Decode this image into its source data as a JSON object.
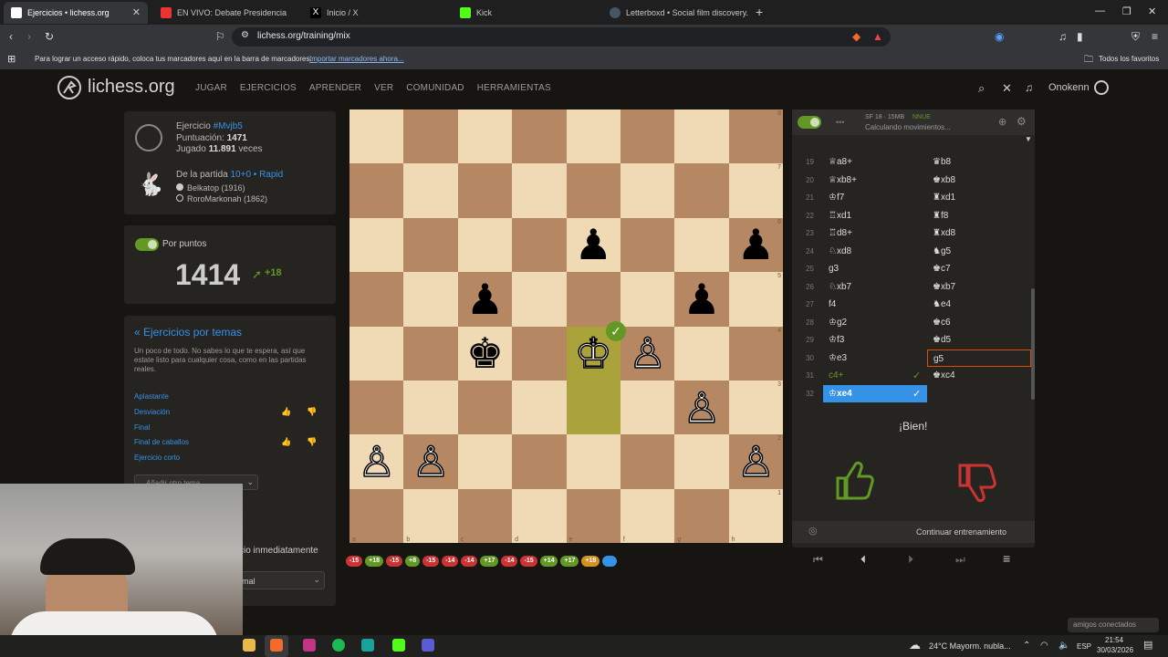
{
  "browser": {
    "tabs": [
      {
        "title": "Ejercicios • lichess.org",
        "active": true
      },
      {
        "title": "EN VIVO: Debate Presidencia",
        "active": false
      },
      {
        "title": "Inicio / X",
        "active": false
      },
      {
        "title": "Kick",
        "active": false
      },
      {
        "title": "Letterboxd • Social film discovery.",
        "active": false
      }
    ],
    "url": "lichess.org/training/mix",
    "bookmarks_hint": "Para lograr un acceso rápido, coloca tus marcadores aquí en la barra de marcadores.",
    "bookmarks_import": "Importar marcadores ahora...",
    "all_favorites": "Todos los favoritos"
  },
  "site": {
    "logo_text": "lichess.org",
    "nav": [
      "JUGAR",
      "EJERCICIOS",
      "APRENDER",
      "VER",
      "COMUNIDAD",
      "HERRAMIENTAS"
    ],
    "username": "Onokenn"
  },
  "puzzle": {
    "label": "Ejercicio",
    "id": "#Mvjb5",
    "rating_label": "Puntuación:",
    "rating": "1471",
    "played_label": "Jugado",
    "played": "11.891",
    "played_suffix": "veces",
    "from_game": "De la partida",
    "game_type": "10+0 • Rapid",
    "white_player": "Belkatop (1916)",
    "black_player": "RoroMarkonah (1862)"
  },
  "score": {
    "label": "Por puntos",
    "value": "1414",
    "delta": "+18"
  },
  "themes": {
    "title": "« Ejercicios por temas",
    "desc": "Un poco de todo. No sabes lo que te espera, así que estate listo para cualquier cosa, como en las partidas reales.",
    "items": [
      "Aplastante",
      "Desviación",
      "Final",
      "Final de caballos",
      "Ejercicio corto"
    ],
    "add": "Añadir otro tema",
    "partial1": "cio inmediatamente",
    "partial2": "mal"
  },
  "engine": {
    "name": "SF 18 · 15MB",
    "nnue": "NNUE",
    "status": "Calculando movimientos..."
  },
  "moves": [
    {
      "n": "19",
      "w": "♕a8+",
      "b": "♛b8"
    },
    {
      "n": "20",
      "w": "♕xb8+",
      "b": "♚xb8"
    },
    {
      "n": "21",
      "w": "♔f7",
      "b": "♜xd1"
    },
    {
      "n": "22",
      "w": "♖xd1",
      "b": "♜f8"
    },
    {
      "n": "23",
      "w": "♖d8+",
      "b": "♜xd8"
    },
    {
      "n": "24",
      "w": "♘xd8",
      "b": "♞g5"
    },
    {
      "n": "25",
      "w": "g3",
      "b": "♚c7"
    },
    {
      "n": "26",
      "w": "♘xb7",
      "b": "♚xb7"
    },
    {
      "n": "27",
      "w": "f4",
      "b": "♞e4"
    },
    {
      "n": "28",
      "w": "♔g2",
      "b": "♚c6"
    },
    {
      "n": "29",
      "w": "♔f3",
      "b": "♚d5"
    },
    {
      "n": "30",
      "w": "♔e3",
      "b": "g5"
    },
    {
      "n": "31",
      "w": "c4+",
      "b": "♚xc4"
    },
    {
      "n": "32",
      "w": "♔xe4",
      "b": ""
    }
  ],
  "feedback": {
    "good": "¡Bien!",
    "continue": "Continuar entrenamiento"
  },
  "chips": [
    {
      "t": "-15",
      "c": "r"
    },
    {
      "t": "+18",
      "c": "g"
    },
    {
      "t": "-15",
      "c": "r"
    },
    {
      "t": "+8",
      "c": "g"
    },
    {
      "t": "-15",
      "c": "r"
    },
    {
      "t": "-14",
      "c": "r"
    },
    {
      "t": "-14",
      "c": "r"
    },
    {
      "t": "+17",
      "c": "g"
    },
    {
      "t": "-14",
      "c": "r"
    },
    {
      "t": "-15",
      "c": "r"
    },
    {
      "t": "+14",
      "c": "g"
    },
    {
      "t": "+17",
      "c": "g"
    },
    {
      "t": "+18",
      "c": "o"
    },
    {
      "t": "",
      "c": "bl"
    }
  ],
  "board": {
    "ranks": [
      "8",
      "7",
      "6",
      "5",
      "4",
      "3",
      "2",
      "1"
    ],
    "files": [
      "a",
      "b",
      "c",
      "d",
      "e",
      "f",
      "g",
      "h"
    ],
    "pieces": [
      {
        "sq": "e6",
        "p": "♟",
        "c": "b"
      },
      {
        "sq": "h6",
        "p": "♟",
        "c": "b"
      },
      {
        "sq": "c5",
        "p": "♟",
        "c": "b"
      },
      {
        "sq": "g5",
        "p": "♟",
        "c": "b"
      },
      {
        "sq": "c4",
        "p": "♚",
        "c": "b"
      },
      {
        "sq": "e4",
        "p": "♔",
        "c": "w"
      },
      {
        "sq": "f4",
        "p": "♙",
        "c": "w"
      },
      {
        "sq": "g3",
        "p": "♙",
        "c": "w"
      },
      {
        "sq": "a2",
        "p": "♙",
        "c": "w"
      },
      {
        "sq": "b2",
        "p": "♙",
        "c": "w"
      },
      {
        "sq": "h2",
        "p": "♙",
        "c": "w"
      }
    ],
    "highlights": [
      "e4",
      "e3"
    ]
  },
  "taskbar": {
    "weather": "24°C  Mayorm. nubla...",
    "lang": "ESP",
    "time": "21:54",
    "date": "30/03/2026",
    "friends": "amigos conectados"
  },
  "colors": {
    "accent": "#629924",
    "blue": "#3692e7",
    "bad": "#cc3333"
  }
}
